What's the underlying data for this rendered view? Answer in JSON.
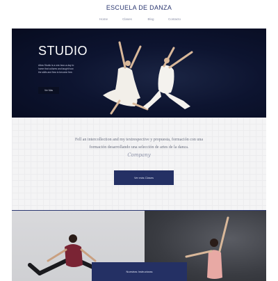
{
  "header": {
    "brand": "ESCUELA DE DANZA",
    "nav": [
      "Home",
      "Clases",
      "Blog",
      "Contacto"
    ]
  },
  "hero": {
    "title": "STUDIO",
    "text": "Allow Studio is a one-hour-a-day to home that cultures and taught how the skills and flow to become free.",
    "button": "Ver Más"
  },
  "intro": {
    "text_line1": "Fell an intercollection and my textrespective y propuesta, formación con una",
    "text_line2": "formación desarrollando una selección de artes de la danza.",
    "signature": "Company",
    "button": "Ver más Clases"
  },
  "gallery": {
    "button": "Nuestras Instructoras"
  },
  "colors": {
    "navy": "#243064",
    "hero_bg": "#0d1430",
    "brand_text": "#2a3670"
  }
}
